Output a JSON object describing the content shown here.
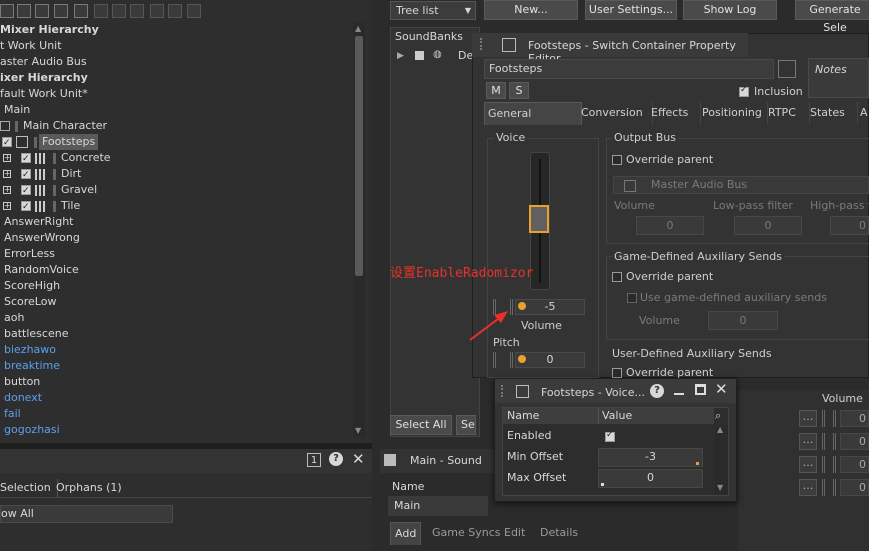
{
  "toolbar": {
    "dropdown_value": "Tree list",
    "new_button": "New...",
    "user_settings_button": "User Settings...",
    "show_log_button": "Show Log",
    "generate_button": "Generate Sele"
  },
  "left_tree": {
    "rows": [
      {
        "label": "Mixer Hierarchy",
        "style": "bold"
      },
      {
        "label": "t Work Unit",
        "style": "normal"
      },
      {
        "label": "aster Audio Bus",
        "style": "normal"
      },
      {
        "label": "ixer Hierarchy",
        "style": "bold"
      },
      {
        "label": "fault Work Unit*",
        "style": "normal"
      },
      {
        "label": "Main",
        "style": "normal"
      },
      {
        "label": "Main Character",
        "style": "normal"
      },
      {
        "label": "Footsteps",
        "style": "selected"
      },
      {
        "label": "Concrete",
        "style": "normal"
      },
      {
        "label": "Dirt",
        "style": "normal"
      },
      {
        "label": "Gravel",
        "style": "normal"
      },
      {
        "label": "Tile",
        "style": "normal"
      },
      {
        "label": "AnswerRight",
        "style": "normal"
      },
      {
        "label": "AnswerWrong",
        "style": "normal"
      },
      {
        "label": "ErrorLess",
        "style": "normal"
      },
      {
        "label": "RandomVoice",
        "style": "normal"
      },
      {
        "label": "ScoreHigh",
        "style": "normal"
      },
      {
        "label": "ScoreLow",
        "style": "normal"
      },
      {
        "label": "aoh",
        "style": "normal"
      },
      {
        "label": "battlescene",
        "style": "normal"
      },
      {
        "label": "biezhawo",
        "style": "blue"
      },
      {
        "label": "breaktime",
        "style": "blue"
      },
      {
        "label": "button",
        "style": "normal"
      },
      {
        "label": "donext",
        "style": "blue"
      },
      {
        "label": "fail",
        "style": "blue"
      },
      {
        "label": "gogozhasi",
        "style": "blue"
      }
    ]
  },
  "bottom_left": {
    "badge": "1",
    "tab_selection": "Selection",
    "tab_orphans": "Orphans (1)",
    "filter_label": "ow All"
  },
  "soundbanks": {
    "header": "SoundBanks",
    "row_label": "De",
    "select_all": "Select All",
    "second_button": "Se"
  },
  "property_editor": {
    "title": "Footsteps - Switch Container Property Editor",
    "name_value": "Footsteps",
    "notes_label": "Notes",
    "m_button": "M",
    "s_button": "S",
    "inclusion_label": "Inclusion",
    "tabs": [
      "General Settings",
      "Conversion",
      "Effects",
      "Positioning",
      "RTPC",
      "States",
      "A"
    ],
    "voice_label": "Voice",
    "volume_value": "-5",
    "volume_label": "Volume",
    "pitch_label": "Pitch",
    "pitch_value": "0",
    "output_bus_label": "Output Bus",
    "override_parent_1": "Override parent",
    "master_audio_bus": "Master Audio Bus",
    "col_volume": "Volume",
    "col_lowpass": "Low-pass filter",
    "col_highpass": "High-pass fil",
    "val_volume": "0",
    "val_lowpass": "0",
    "val_highpass": "0",
    "game_defined_label": "Game-Defined Auxiliary Sends",
    "override_parent_2": "Override parent",
    "use_game_defined": "Use game-defined auxiliary sends",
    "gd_volume_label": "Volume",
    "gd_volume_value": "0",
    "user_defined_label": "User-Defined Auxiliary Sends",
    "override_parent_3": "Override parent",
    "right_col_header": "Volume",
    "right_col_values": [
      "0",
      "0",
      "0",
      "0"
    ]
  },
  "annotation": {
    "text": "设置EnableRadomizor",
    "color": "#e8312a"
  },
  "popup": {
    "title": "Footsteps - Voice...",
    "col_name": "Name",
    "col_value": "Value",
    "rows": [
      {
        "name": "Enabled",
        "value": ""
      },
      {
        "name": "Min Offset",
        "value": "-3"
      },
      {
        "name": "Max Offset",
        "value": "0"
      }
    ]
  },
  "main_sound": {
    "title": "Main - Sound",
    "name_label": "Name",
    "name_value": "Main",
    "tabs": [
      "Add",
      "Game Syncs",
      "Edit",
      "Details"
    ]
  },
  "colors": {
    "accent_orange": "#e8a030",
    "link_blue": "#5aa0f0"
  }
}
